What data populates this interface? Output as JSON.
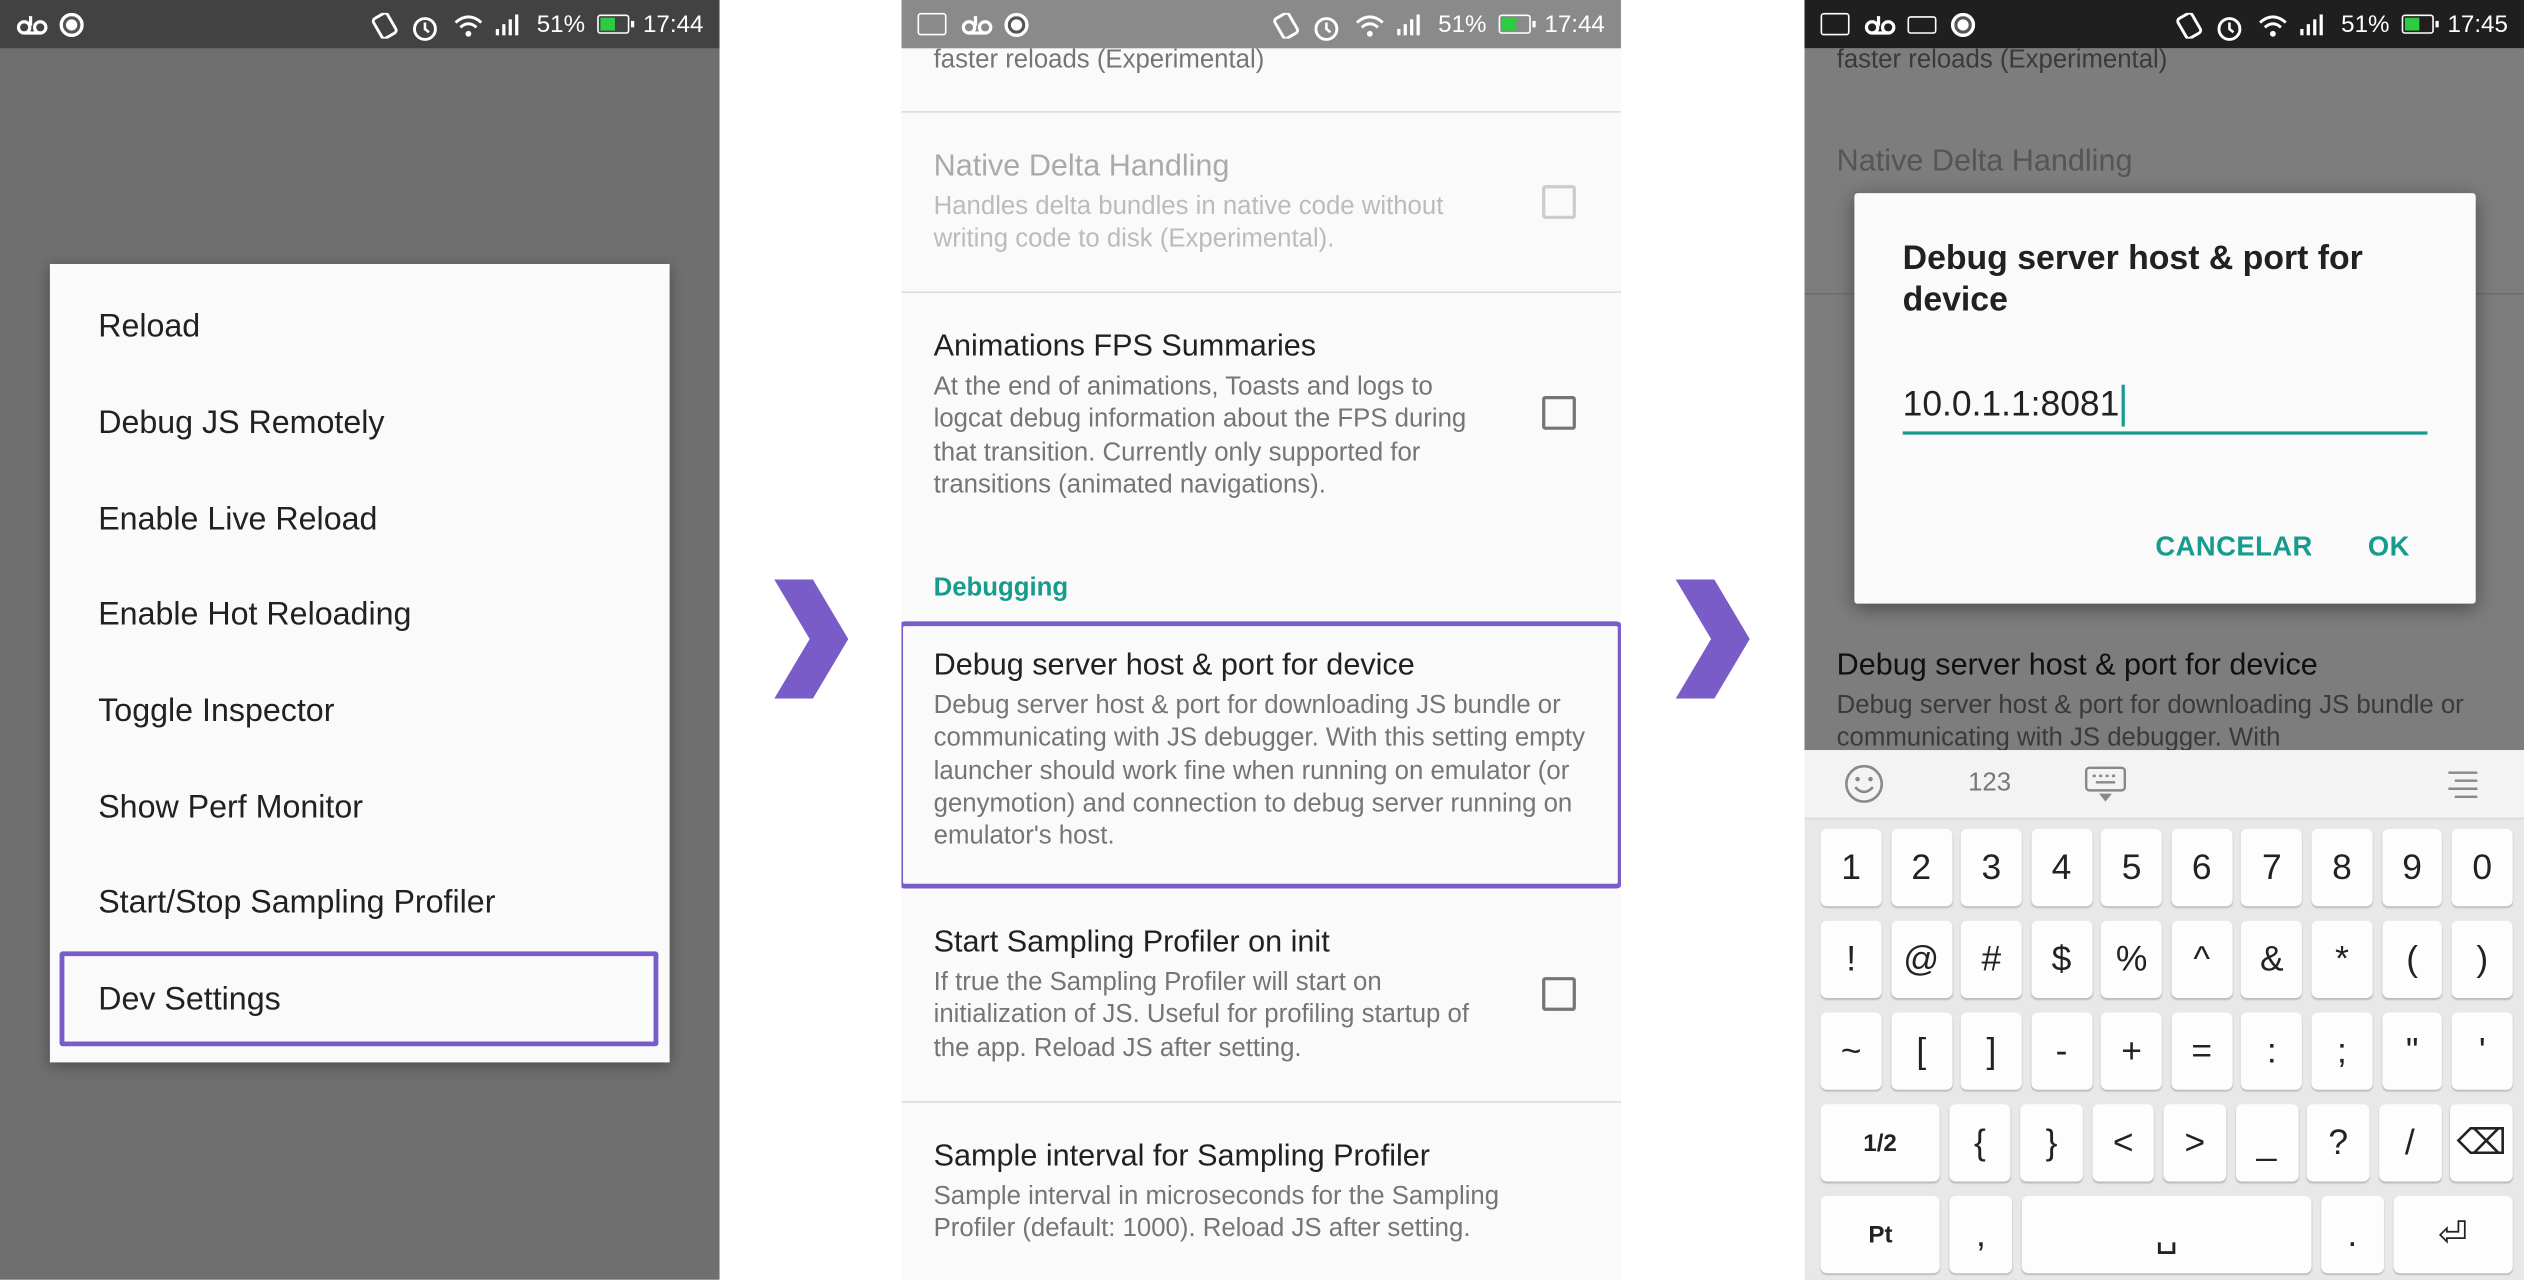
{
  "statusbar_1": {
    "battery": "51%",
    "time": "17:44"
  },
  "statusbar_2": {
    "battery": "51%",
    "time": "17:44"
  },
  "statusbar_3": {
    "battery": "51%",
    "time": "17:45"
  },
  "dev_menu": {
    "items": [
      "Reload",
      "Debug JS Remotely",
      "Enable Live Reload",
      "Enable Hot Reloading",
      "Toggle Inspector",
      "Show Perf Monitor",
      "Start/Stop Sampling Profiler",
      "Dev Settings"
    ]
  },
  "settings": {
    "top_fragment": "faster reloads (Experimental)",
    "native_delta": {
      "title": "Native Delta Handling",
      "summary": "Handles delta bundles in native code without writing code to disk (Experimental)."
    },
    "animations_fps": {
      "title": "Animations FPS Summaries",
      "summary": "At the end of animations, Toasts and logs to logcat debug information about the FPS during that transition. Currently only supported for transitions (animated navigations)."
    },
    "section_debugging": "Debugging",
    "debug_server": {
      "title": "Debug server host & port for device",
      "summary": "Debug server host & port for downloading JS bundle or communicating with JS debugger. With this setting empty launcher should work fine when running on emulator (or genymotion) and connection to debug server running on emulator's host."
    },
    "sampling_profiler_init": {
      "title": "Start Sampling Profiler on init",
      "summary": "If true the Sampling Profiler will start on initialization of JS. Useful for profiling startup of the app. Reload JS after setting."
    },
    "sample_interval": {
      "title": "Sample interval for Sampling Profiler",
      "summary": "Sample interval in microseconds for the Sampling Profiler (default: 1000). Reload JS after setting."
    }
  },
  "bg_settings": {
    "top_fragment": "faster reloads (Experimental)",
    "native_delta_title": "Native Delta Handling",
    "debug_title": "Debug server host & port for device",
    "debug_summary": "Debug server host & port for downloading JS bundle or communicating with JS debugger. With"
  },
  "dialog": {
    "title": "Debug server host & port for device",
    "value": "10.0.1.1:8081",
    "cancel": "CANCELAR",
    "ok": "OK"
  },
  "keyboard": {
    "mode_label": "123",
    "rows": [
      [
        "1",
        "2",
        "3",
        "4",
        "5",
        "6",
        "7",
        "8",
        "9",
        "0"
      ],
      [
        "!",
        "@",
        "#",
        "$",
        "%",
        "^",
        "&",
        "*",
        "(",
        ")"
      ],
      [
        "~",
        "[",
        "]",
        "-",
        "+",
        "=",
        ":",
        ";",
        "\"",
        "'"
      ],
      [
        "1/2",
        "{",
        "}",
        "<",
        ">",
        "_",
        "?",
        "/",
        "⌫"
      ],
      [
        "Pt",
        ",",
        "␣",
        ".",
        "⏎"
      ]
    ]
  },
  "colors": {
    "accent": "#169c8c",
    "highlight": "#7a5cc8"
  }
}
